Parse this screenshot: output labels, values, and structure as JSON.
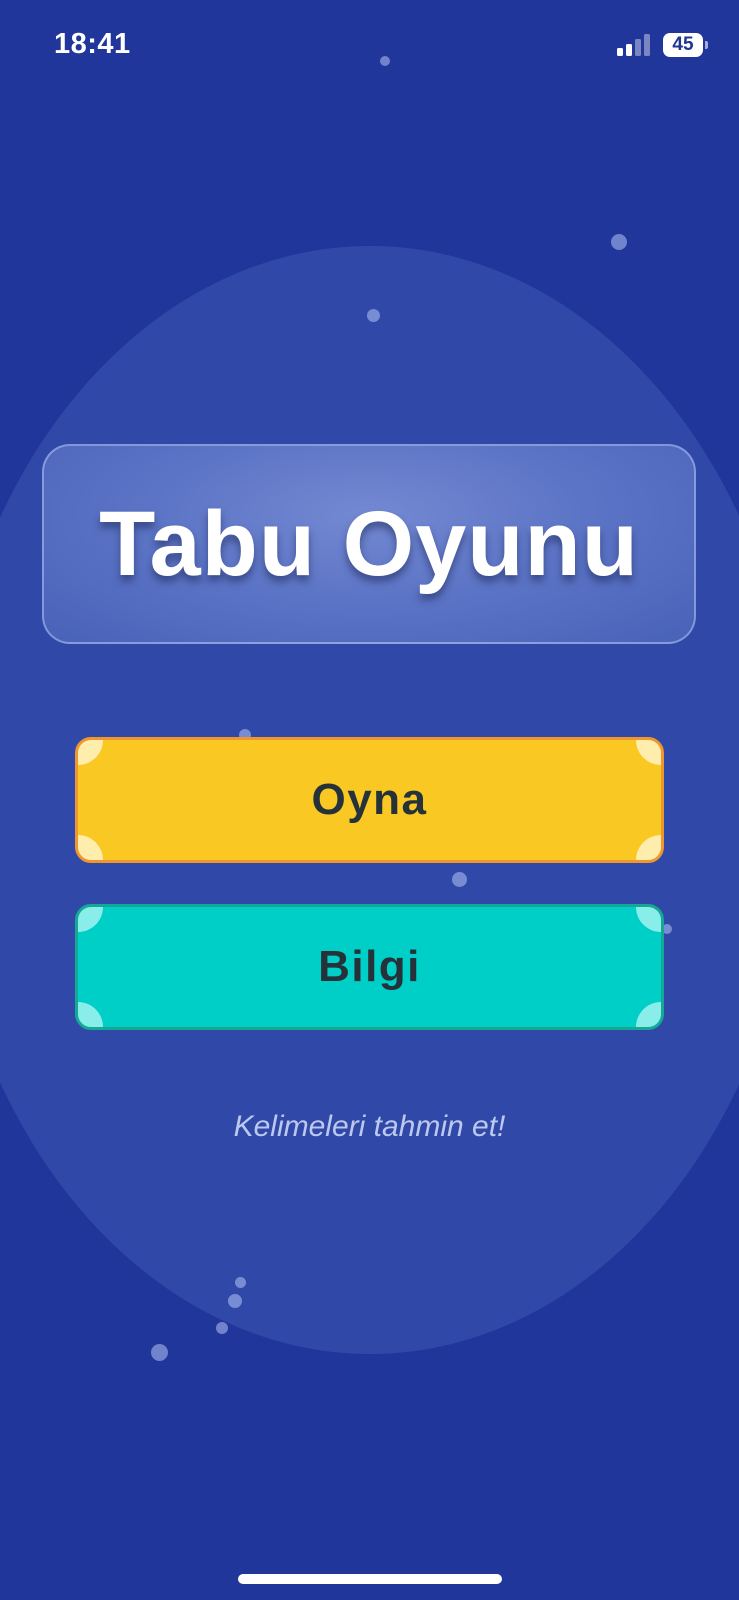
{
  "status_bar": {
    "time": "18:41",
    "battery_level": "45"
  },
  "title": "Tabu Oyunu",
  "buttons": {
    "play_label": "Oyna",
    "info_label": "Bilgi"
  },
  "tagline": "Kelimeleri tahmin et!",
  "colors": {
    "background": "#21369a",
    "circle": "#3049a8",
    "play_button": "#f9c823",
    "play_border": "#f0962e",
    "info_button": "#00cfc8",
    "info_border": "#14a895",
    "button_text": "#26323a"
  },
  "icons": [
    "cellular-signal-icon",
    "battery-icon"
  ]
}
